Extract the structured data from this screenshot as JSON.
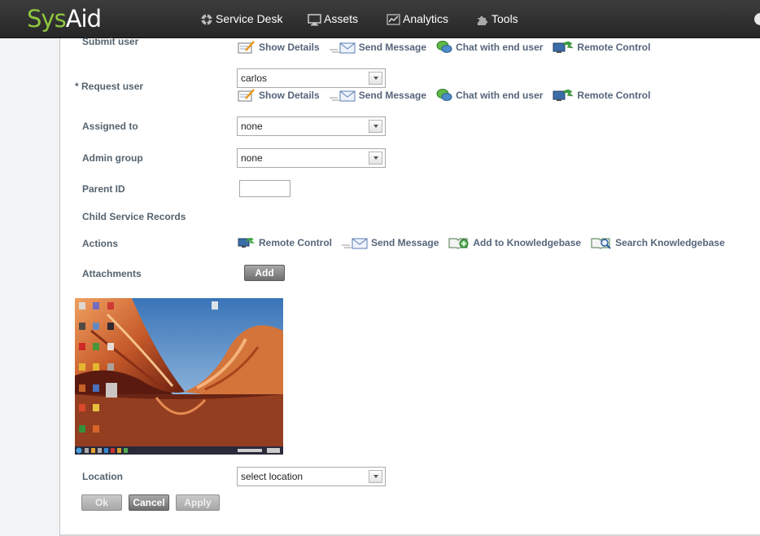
{
  "app": {
    "logo_part1": "Sys",
    "logo_part2": "Aid"
  },
  "nav": {
    "items": [
      {
        "label": "Service Desk",
        "icon": "lifebuoy-icon"
      },
      {
        "label": "Assets",
        "icon": "monitor-icon"
      },
      {
        "label": "Analytics",
        "icon": "chart-icon"
      },
      {
        "label": "Tools",
        "icon": "puzzle-icon"
      }
    ]
  },
  "form": {
    "submit_user": {
      "label": "Submit user",
      "actions": [
        "Show Details",
        "Send Message",
        "Chat with end user",
        "Remote Control"
      ]
    },
    "request_user": {
      "required_mark": "*",
      "label": "Request user",
      "value": "carlos",
      "actions": [
        "Show Details",
        "Send Message",
        "Chat with end user",
        "Remote Control"
      ]
    },
    "assigned_to": {
      "label": "Assigned to",
      "value": "none"
    },
    "admin_group": {
      "label": "Admin group",
      "value": "none"
    },
    "parent_id": {
      "label": "Parent ID",
      "value": ""
    },
    "child_records": {
      "label": "Child Service Records"
    },
    "actions": {
      "label": "Actions",
      "items": [
        "Remote Control",
        "Send Message",
        "Add to Knowledgebase",
        "Search Knowledgebase"
      ]
    },
    "attachments": {
      "label": "Attachments",
      "add_button": "Add"
    },
    "location": {
      "label": "Location",
      "value": "select location"
    }
  },
  "buttons": {
    "ok": "Ok",
    "cancel": "Cancel",
    "apply": "Apply"
  },
  "colors": {
    "brand_green": "#8fc63f",
    "topbar": "#2f2f2f",
    "label": "#55636e",
    "action_text": "#56657a"
  }
}
